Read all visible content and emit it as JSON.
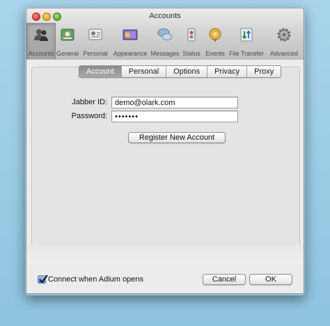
{
  "window": {
    "title": "Accounts"
  },
  "toolbar": {
    "items": [
      {
        "label": "Accounts",
        "icon": "accounts-icon"
      },
      {
        "label": "General",
        "icon": "general-icon"
      },
      {
        "label": "Personal",
        "icon": "personal-icon"
      },
      {
        "label": "Appearance",
        "icon": "appearance-icon"
      },
      {
        "label": "Messages",
        "icon": "messages-icon"
      },
      {
        "label": "Status",
        "icon": "status-icon"
      },
      {
        "label": "Events",
        "icon": "events-icon"
      },
      {
        "label": "File Transfer",
        "icon": "file-transfer-icon"
      },
      {
        "label": "Advanced",
        "icon": "advanced-icon"
      }
    ],
    "selected": "Accounts"
  },
  "tabs": [
    "Account",
    "Personal",
    "Options",
    "Privacy",
    "Proxy"
  ],
  "active_tab": "Account",
  "form": {
    "jabber_label": "Jabber ID:",
    "jabber_value": "demo@olark.com",
    "password_label": "Password:",
    "password_value": "•••••••"
  },
  "register_button": "Register New Account",
  "footer": {
    "checkbox_label": "Connect when Adium opens",
    "checkbox_checked": true,
    "cancel": "Cancel",
    "ok": "OK"
  }
}
